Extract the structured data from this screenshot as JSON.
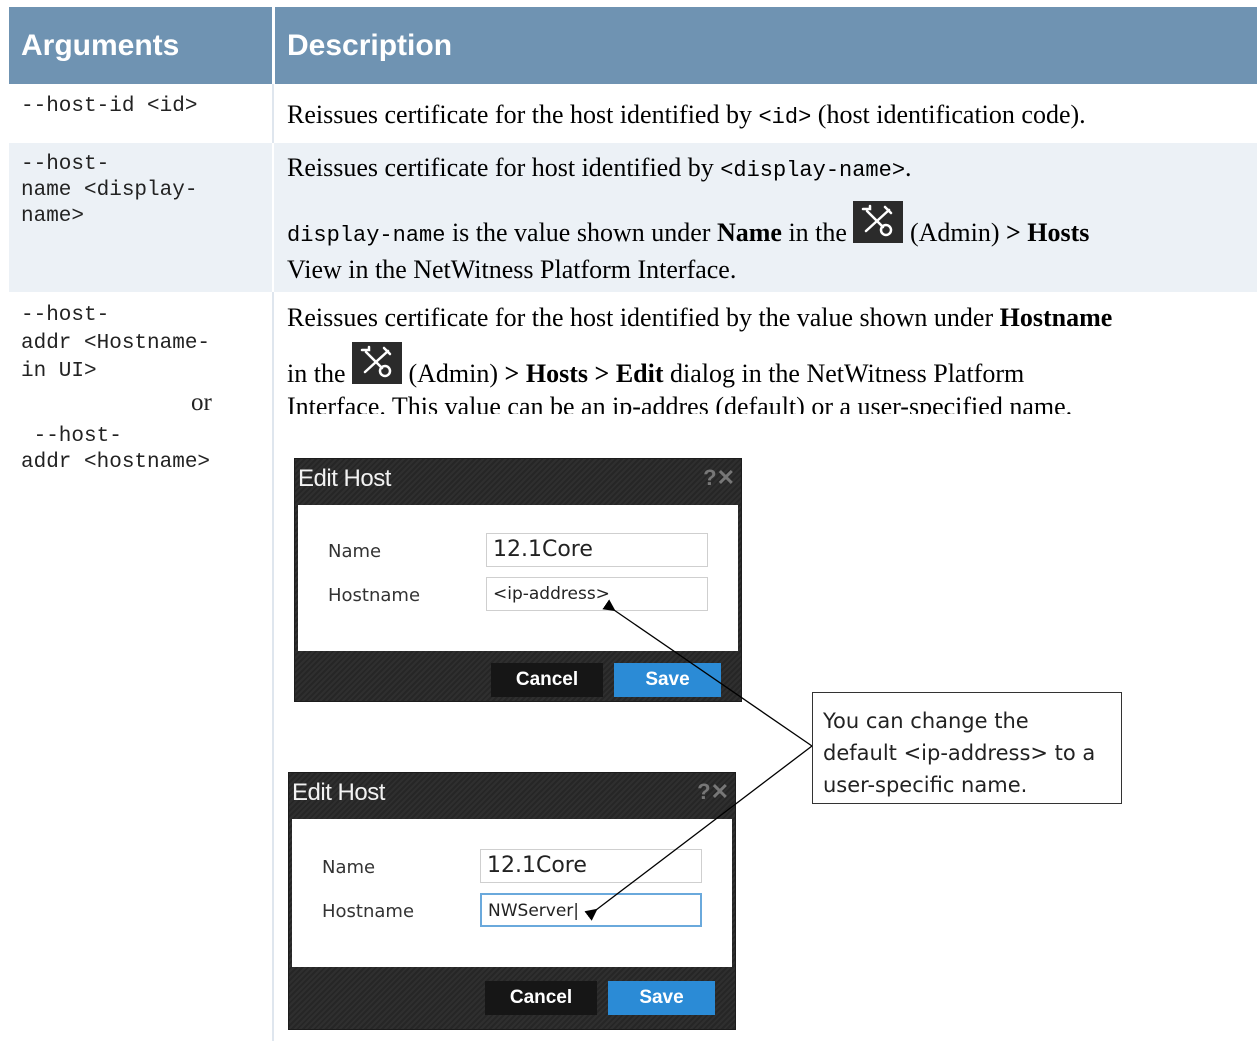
{
  "table": {
    "headers": {
      "arguments": "Arguments",
      "description": "Description"
    },
    "rows": [
      {
        "arg": "--host-id <id>",
        "desc": {
          "p1": "Reissues certificate for the host identified by ",
          "code": "<id>",
          "p2": " (host identification code)."
        }
      },
      {
        "arg": "--host-\nname <display-\nname>",
        "desc": {
          "line1_text": "Reissues certificate for host identified by ",
          "line1_code": "<display-name>",
          "line1_end": ".",
          "line2_code": "display-name",
          "line2_a": " is the value shown under ",
          "line2_bold": "Name",
          "line2_b": " in the ",
          "line2_admin": " (Admin) ",
          "line2_hosts": " > Hosts",
          "line3": "View in the NetWitness Platform Interface."
        }
      },
      {
        "arg_a": "--host-\naddr <Hostname-\nin UI>",
        "arg_or": "or",
        "arg_b": " --host-\naddr <hostname>",
        "desc": {
          "line1_a": "Reissues certificate for the host identified by the value shown under ",
          "line1_bold": "Hostname",
          "line2_a": "in the ",
          "line2_admin": " (Admin) ",
          "line2_hosts": " > Hosts",
          "line2_gt": " > ",
          "line2_edit": "Edit",
          "line2_b": " dialog in the NetWitness Platform",
          "line3": "Interface. This value can be an ip-addres (default) or a user-specified name."
        }
      }
    ]
  },
  "dialogs": [
    {
      "title": "Edit Host",
      "controls": "?✕",
      "name_label": "Name",
      "name_value": "12.1Core",
      "hostname_label": "Hostname",
      "hostname_value": "<ip-address>",
      "cancel": "Cancel",
      "save": "Save"
    },
    {
      "title": "Edit Host",
      "controls": "?✕",
      "name_label": "Name",
      "name_value": "12.1Core",
      "hostname_label": "Hostname",
      "hostname_value": "NWServer|",
      "cancel": "Cancel",
      "save": "Save"
    }
  ],
  "callout": {
    "line1": "You can change the",
    "line2": "default <ip-address> to a",
    "line3": "user-specific name."
  },
  "colors": {
    "header": "#6f93b2",
    "alt_row": "#ecf1f6",
    "save_button": "#2b8bd6"
  },
  "icons": {
    "admin": "admin-tools-icon"
  }
}
